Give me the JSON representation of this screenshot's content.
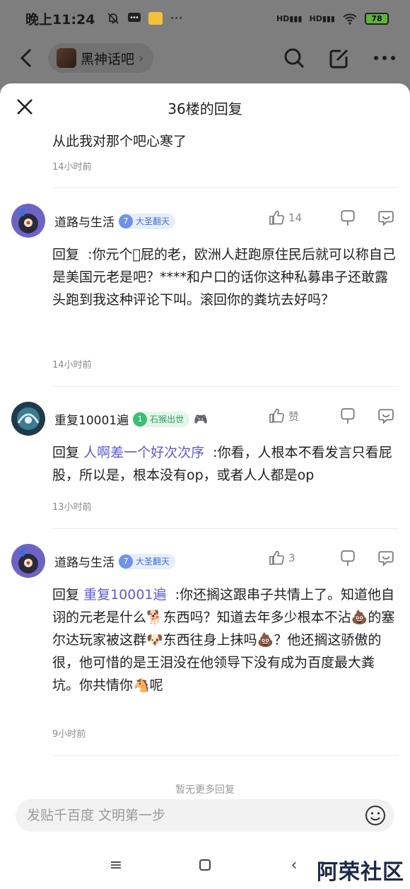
{
  "status_bar": {
    "time": "晚上11:24",
    "battery": "78",
    "net1": "HD",
    "net2": "HD"
  },
  "top_bar": {
    "forum_name": "黑神话吧",
    "chevron": "›"
  },
  "sheet": {
    "title": "36楼的回复"
  },
  "first_reply": {
    "text": "从此我对那个吧心寒了",
    "time": "14小时前"
  },
  "comments": [
    {
      "name": "道路与生活",
      "level": "7",
      "level_title": "大圣翻天",
      "likes": "14",
      "reply_prefix": "回复",
      "mention": "",
      "text": ":你元个\u0000屁的老，欧洲人赶跑原住民后就可以称自己是美国元老是吧？****和户口的话你这种私募串子还敢露头跑到我这种评论下叫。滚回你的粪坑去好吗？",
      "time": "14小时前"
    },
    {
      "name": "重复10001遍",
      "level": "1",
      "level_title": "石猴出世",
      "likes": "赞",
      "reply_prefix": "回复",
      "mention": "人啊差一个好次次序",
      "text": ":你看，人根本不看发言只看屁股，所以是，根本没有op，或者人人都是op",
      "time": "13小时前"
    },
    {
      "name": "道路与生活",
      "level": "7",
      "level_title": "大圣翻天",
      "likes": "3",
      "reply_prefix": "回复",
      "mention": "重复10001遍",
      "text": ":你还搁这跟串子共情上了。知道他自诩的元老是什么🐕东西吗？知道去年多少根本不沾💩的塞尔达玩家被这群🐶东西往身上抹吗💩？他还搁这骄傲的很，他可惜的是王泪没在他领导下没有成为百度最大粪坑。你共情你🐴呢",
      "time": "9小时前"
    }
  ],
  "no_more_text": "暂无更多回复",
  "input": {
    "placeholder": "发贴千百度 文明第一步"
  },
  "nav": {
    "back": "‹",
    "menu": "≡"
  },
  "watermark": "阿荣社区",
  "colors": {
    "mention": "#5b5bd6",
    "dim_overlay": "#7e7e7e",
    "level_blue": "#6f93e8",
    "level_green": "#3cbf74"
  }
}
